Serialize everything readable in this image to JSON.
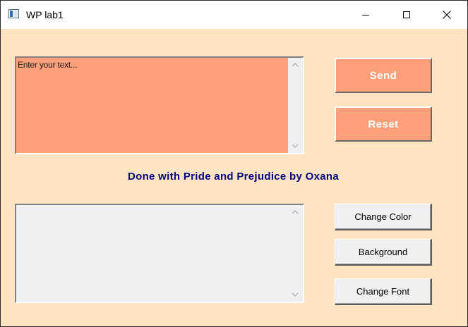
{
  "window": {
    "title": "WP lab1"
  },
  "input_box": {
    "text": "Enter your text..."
  },
  "output_box": {
    "text": ""
  },
  "label": {
    "text": "Done with Pride and Prejudice by Oxana"
  },
  "buttons": {
    "send": "Send",
    "reset": "Reset",
    "change_color": "Change Color",
    "background": "Background",
    "change_font": "Change Font"
  },
  "colors": {
    "client_background": "#ffe4c4",
    "input_background": "#ffa07a",
    "label_color": "#000080",
    "button_accent": "#ffa07a"
  },
  "icons": {
    "app": "app-window-icon",
    "minimize": "minimize-icon",
    "maximize": "maximize-icon",
    "close": "close-icon",
    "scroll_up": "chevron-up-icon",
    "scroll_down": "chevron-down-icon"
  }
}
